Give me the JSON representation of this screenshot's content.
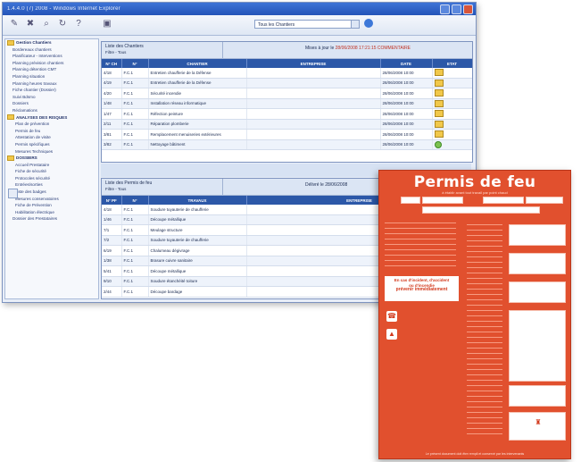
{
  "window": {
    "title": "1.4.4.0 (7) 2008 - Windows Internet Explorer",
    "combo_value": "Tous les Chantiers"
  },
  "tree": [
    {
      "label": "Gestion Chantiers",
      "level": 0
    },
    {
      "label": "Bordereaux chantiers",
      "level": 1
    },
    {
      "label": "Planificateur - Interventions",
      "level": 1
    },
    {
      "label": "Planning prévision chantiers",
      "level": 1
    },
    {
      "label": "Planning détention CMT",
      "level": 1
    },
    {
      "label": "Planning situation",
      "level": 1
    },
    {
      "label": "Planning heures travaux",
      "level": 1
    },
    {
      "label": "Fiche chantier (Dossier)",
      "level": 1
    },
    {
      "label": "Suivi Bdsmo",
      "level": 1
    },
    {
      "label": "Dossiers",
      "level": 1
    },
    {
      "label": "Réclamations",
      "level": 1
    },
    {
      "label": "ANALYSES DES RISQUES",
      "level": 0
    },
    {
      "label": "Plan de prévention",
      "level": 2
    },
    {
      "label": "Permis de feu",
      "level": 2
    },
    {
      "label": "Attestation de visite",
      "level": 2
    },
    {
      "label": "Permis spécifiques",
      "level": 2
    },
    {
      "label": "Mesures Techniques",
      "level": 2
    },
    {
      "label": "DOSSIERS",
      "level": 0
    },
    {
      "label": "Accueil Prestataire",
      "level": 2
    },
    {
      "label": "Fiche de sécurité",
      "level": 2
    },
    {
      "label": "Protocoles sécurité",
      "level": 2
    },
    {
      "label": "Entrées/sorties",
      "level": 2
    },
    {
      "label": "Liste des badges",
      "level": 2
    },
    {
      "label": "Mesures conservatoires",
      "level": 2
    },
    {
      "label": "Fiche de Prévention",
      "level": 2
    },
    {
      "label": "Habilitation électrique",
      "level": 2
    },
    {
      "label": "Dossier des Prestataires",
      "level": 1
    }
  ],
  "panel1": {
    "title": "Liste des Chantiers",
    "subtitle": "Filtre - Tous",
    "right_label": "Mises à jour le",
    "right_value": "28/06/2008 17:21:15 COMMENTAIRE",
    "headers": [
      "N° CH",
      "N°",
      "CHANTIER",
      "ENTREPRISE",
      "DATE",
      "ETAT"
    ],
    "rows": [
      [
        "4/18",
        "F.C.1",
        "Entretien chaufferie de la Défense",
        "",
        "28/06/2008 10:00",
        "folder"
      ],
      [
        "4/19",
        "F.C.1",
        "Entretien chaufferie de la Défense",
        "",
        "28/06/2008 10:00",
        "folder"
      ],
      [
        "4/20",
        "F.C.1",
        "Sécurité incendie",
        "",
        "28/06/2008 10:00",
        "folder"
      ],
      [
        "1/48",
        "F.C.1",
        "Installation réseau informatique",
        "",
        "28/06/2008 10:00",
        "folder"
      ],
      [
        "1/47",
        "F.C.1",
        "Réfection peinture",
        "",
        "28/06/2008 10:00",
        "folder"
      ],
      [
        "2/11",
        "F.C.1",
        "Réparation plomberie",
        "",
        "28/06/2008 10:00",
        "folder"
      ],
      [
        "3/81",
        "F.C.1",
        "Remplacement menuiseries extérieures",
        "",
        "28/06/2008 10:00",
        "folder"
      ],
      [
        "3/82",
        "F.C.1",
        "Nettoyage bâtiment",
        "",
        "28/06/2008 10:00",
        "check"
      ]
    ]
  },
  "panel2": {
    "title": "Liste des Permis de feu",
    "subtitle": "Filtre - Tous",
    "right_value": "Délivré le 28/06/2008",
    "headers": [
      "N° PF",
      "N°",
      "TRAVAUX",
      "ENTREPRISE"
    ],
    "rows": [
      [
        "4/18",
        "F.C.1",
        "Soudure tuyauterie de chaufferie",
        ""
      ],
      [
        "1/46",
        "F.C.1",
        "Découpe métallique",
        ""
      ],
      [
        "7/1",
        "F.C.1",
        "Meulage structure",
        ""
      ],
      [
        "7/2",
        "F.C.1",
        "Soudure tuyauterie de chaufferie",
        ""
      ],
      [
        "6/19",
        "F.C.1",
        "Chalumeau dégivrage",
        ""
      ],
      [
        "1/38",
        "F.C.1",
        "Brasure cuivre sanitaire",
        ""
      ],
      [
        "5/41",
        "F.C.1",
        "Découpe métallique",
        ""
      ],
      [
        "9/10",
        "F.C.1",
        "Soudure étanchéité toiture",
        ""
      ],
      [
        "2/44",
        "F.C.1",
        "Découpe bardage",
        ""
      ]
    ]
  },
  "poster": {
    "title": "Permis de feu",
    "subtitle": "à établir avant tout travail par point chaud",
    "warning_l1": "En cas d'incident, d'accident",
    "warning_l2": "ou d'incendie",
    "warning_l3": "prévenir immédiatement",
    "footer": "Le présent document doit être rempli et conservé par les intervenants"
  }
}
